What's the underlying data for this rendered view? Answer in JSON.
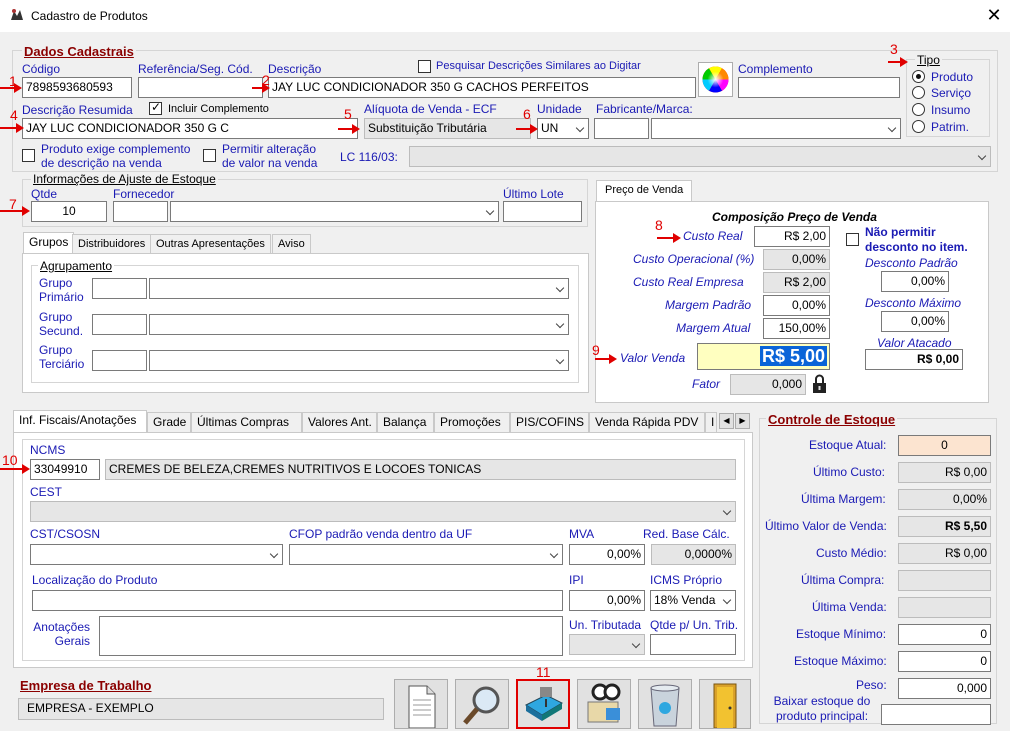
{
  "window": {
    "title": "Cadastro de Produtos",
    "close": "✕"
  },
  "dados": {
    "section": "Dados Cadastrais",
    "codigo_label": "Código",
    "codigo": "7898593680593",
    "referencia_label": "Referência/Seg. Cód.",
    "referencia": "",
    "descricao_label": "Descrição",
    "descricao": "JAY LUC CONDICIONADOR 350 G CACHOS PERFEITOS",
    "pesquisar_label": "Pesquisar Descrições Similares ao Digitar",
    "complemento_label": "Complemento",
    "complemento": "",
    "desc_resumida_label": "Descrição Resumida",
    "desc_resumida": "JAY LUC CONDICIONADOR 350 G C",
    "incluir_complemento_label": "Incluir Complemento",
    "aliquota_label": "Alíquota de Venda - ECF",
    "aliquota": "Substituição Tributária",
    "unidade_label": "Unidade",
    "unidade": "UN",
    "fabricante_label": "Fabricante/Marca:",
    "fabricante_cod": "",
    "fabricante": "",
    "exige_complemento_label": "Produto exige complemento de descrição na venda",
    "permitir_alteracao_label": "Permitir alteração de valor na venda",
    "lc_label": "LC 116/03:",
    "lc": ""
  },
  "tipo": {
    "label": "Tipo",
    "options": [
      "Produto",
      "Serviço",
      "Insumo",
      "Patrim."
    ],
    "selected": "Produto"
  },
  "ajuste": {
    "label": "Informações de Ajuste de Estoque",
    "qtde_label": "Qtde",
    "qtde": "10",
    "fornecedor_label": "Fornecedor",
    "fornecedor_cod": "",
    "fornecedor": "",
    "ultimo_lote_label": "Último Lote",
    "ultimo_lote": ""
  },
  "grupos_tabs": [
    "Grupos",
    "Distribuidores",
    "Outras Apresentações",
    "Aviso"
  ],
  "agrupamento": {
    "label": "Agrupamento",
    "primario_label": "Grupo Primário",
    "secund_label": "Grupo Secund.",
    "terciario_label": "Grupo Terciário"
  },
  "preco": {
    "tab": "Preço de Venda",
    "title": "Composição Preço de Venda",
    "custo_real_label": "Custo Real",
    "custo_real": "R$ 2,00",
    "custo_operacional_label": "Custo Operacional (%)",
    "custo_operacional": "0,00%",
    "custo_real_empresa_label": "Custo Real Empresa",
    "custo_real_empresa": "R$ 2,00",
    "margem_padrao_label": "Margem Padrão",
    "margem_padrao": "0,00%",
    "margem_atual_label": "Margem Atual",
    "margem_atual": "150,00%",
    "valor_venda_label": "Valor Venda",
    "valor_venda": "R$ 5,00",
    "fator_label": "Fator",
    "fator": "0,000",
    "nao_permitir_label": "Não permitir desconto no item.",
    "desconto_padrao_label": "Desconto Padrão",
    "desconto_padrao": "0,00%",
    "desconto_maximo_label": "Desconto Máximo",
    "desconto_maximo": "0,00%",
    "valor_atacado_label": "Valor Atacado",
    "valor_atacado": "R$ 0,00"
  },
  "fiscais_tabs": [
    "Inf. Fiscais/Anotações",
    "Grade",
    "Últimas Compras",
    "Valores Ant.",
    "Balança",
    "Promoções",
    "PIS/COFINS",
    "Venda Rápida PDV",
    "I"
  ],
  "fiscais": {
    "ncms_label": "NCMS",
    "ncms": "33049910",
    "ncms_desc": "CREMES DE BELEZA,CREMES NUTRITIVOS E LOCOES TONICAS",
    "cest_label": "CEST",
    "cest": "",
    "cst_label": "CST/CSOSN",
    "cst": "",
    "cfop_label": "CFOP padrão venda dentro da UF",
    "cfop": "",
    "mva_label": "MVA",
    "mva": "0,00%",
    "red_base_label": "Red. Base Cálc.",
    "red_base": "0,0000%",
    "localizacao_label": "Localização do Produto",
    "localizacao": "",
    "ipi_label": "IPI",
    "ipi": "0,00%",
    "icms_label": "ICMS Próprio",
    "icms": "18% Venda",
    "anotacoes_label": "Anotações Gerais",
    "anotacoes": "",
    "un_tributada_label": "Un. Tributada",
    "un_tributada": "",
    "qtde_un_trib_label": "Qtde p/ Un. Trib.",
    "qtde_un_trib": ""
  },
  "estoque": {
    "section": "Controle de Estoque",
    "rows": [
      {
        "label": "Estoque Atual:",
        "value": "0"
      },
      {
        "label": "Último Custo:",
        "value": "R$ 0,00"
      },
      {
        "label": "Última Margem:",
        "value": "0,00%"
      },
      {
        "label": "Último Valor de Venda:",
        "value": "R$ 5,50"
      },
      {
        "label": "Custo Médio:",
        "value": "R$ 0,00"
      },
      {
        "label": "Última Compra:",
        "value": ""
      },
      {
        "label": "Última Venda:",
        "value": ""
      },
      {
        "label": "Estoque Mínimo:",
        "value": "0"
      },
      {
        "label": "Estoque Máximo:",
        "value": "0"
      },
      {
        "label": "Peso:",
        "value": "0,000"
      }
    ],
    "baixar_label": "Baixar estoque do produto principal:",
    "baixar": ""
  },
  "empresa": {
    "section": "Empresa de Trabalho",
    "value": "EMPRESA - EXEMPLO"
  },
  "markers": [
    "1",
    "2",
    "3",
    "4",
    "5",
    "6",
    "7",
    "8",
    "9",
    "10",
    "11"
  ],
  "icons": [
    "app-icon",
    "color-wheel-icon",
    "lock-icon",
    "new-document-icon",
    "search-icon",
    "save-icon",
    "search-user-icon",
    "recycle-bin-icon",
    "exit-door-icon"
  ],
  "colors": {
    "accent_label": "#1a1ab4",
    "section": "#8b0000",
    "marker": "#e00000",
    "valor_venda_bg": "#ffffc0",
    "selection": "#0a64d8"
  }
}
